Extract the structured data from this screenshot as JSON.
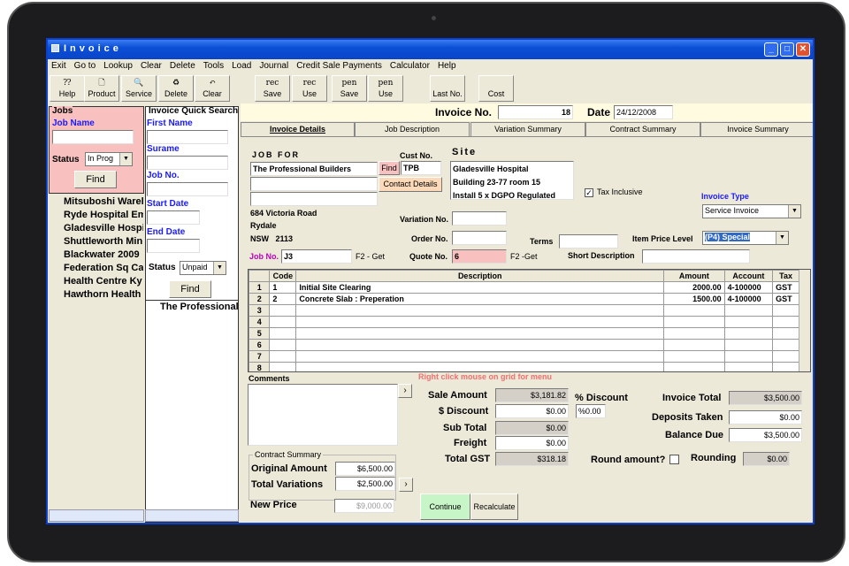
{
  "window": {
    "title": "Invoice"
  },
  "menu": [
    "Exit",
    "Go to",
    "Lookup",
    "Clear",
    "Delete",
    "Tools",
    "Load",
    "Journal",
    "Credit Sale Payments",
    "Calculator",
    "Help"
  ],
  "toolbar": [
    {
      "top": "",
      "label": "Help",
      "icon": "help-icon"
    },
    {
      "top": "",
      "label": "Product",
      "icon": "document-icon"
    },
    {
      "top": "",
      "label": "Service",
      "icon": "service-icon"
    },
    {
      "top": "",
      "label": "Delete",
      "icon": "recycle-bin-icon"
    },
    {
      "top": "",
      "label": "Clear",
      "icon": "undo-icon"
    },
    {
      "top": "rec",
      "label": "Save"
    },
    {
      "top": "rec",
      "label": "Use"
    },
    {
      "top": "pen",
      "label": "Save"
    },
    {
      "top": "pen",
      "label": "Use"
    },
    {
      "top": "",
      "label": "Last No."
    },
    {
      "top": "",
      "label": "Cost"
    }
  ],
  "jobs": {
    "title": "Jobs",
    "job_name_label": "Job Name",
    "job_name": "",
    "status_label": "Status",
    "status": "In Prog",
    "find": "Find"
  },
  "tree": [
    "Mitsuboshi Warehouse",
    "Ryde Hospital Em",
    "Gladesville Hospital",
    "Shuttleworth Min",
    "Blackwater 2009",
    "Federation Sq Ca",
    "Health Centre Ky",
    "Hawthorn Health"
  ],
  "quick": {
    "title": "Invoice Quick Search",
    "first_name": "First Name",
    "surname": "Surame",
    "job_no": "Job No.",
    "start_date": "Start Date",
    "end_date": "End Date",
    "status_label": "Status",
    "status": "Unpaid",
    "find": "Find",
    "tree_item": "The Professional"
  },
  "header": {
    "invoice_no_label": "Invoice No.",
    "invoice_no": "18",
    "date_label": "Date",
    "date": "24/12/2008"
  },
  "tabs": [
    "Invoice Details",
    "Job Description",
    "Variation Summary",
    "Contract Summary",
    "Invoice Summary"
  ],
  "form": {
    "job_for": "JOB FOR",
    "customer": "The Professional Builders",
    "find": "Find",
    "cust_no_label": "Cust No.",
    "cust_no": "TPB",
    "contact": "Contact Details",
    "site_label": "Site",
    "site": [
      "Gladesville Hospital",
      "Building 23-77 room 15",
      "Install 5 x DGPO Regulated"
    ],
    "tax_inclusive": "Tax Inclusive",
    "tax_checked": true,
    "address": [
      "684 Victoria Road",
      "Rydale",
      "NSW   2113"
    ],
    "variation_no": "Variation No.",
    "order_no": "Order No.",
    "terms": "Terms",
    "invoice_type_label": "Invoice Type",
    "invoice_type": "Service Invoice",
    "price_level_label": "Item Price Level",
    "price_level": "(P4) Special",
    "job_no_label": "Job No.",
    "job_no": "J3",
    "f2_get": "F2 - Get",
    "quote_no_label": "Quote No.",
    "quote_no": "6",
    "f2_get2": "F2 -Get",
    "short_desc": "Short Description"
  },
  "grid": {
    "columns": [
      "Code",
      "Description",
      "Amount",
      "Account",
      "Tax"
    ],
    "rows": [
      [
        "1",
        "Initial Site Clearing",
        "2000.00",
        "4-100000",
        "GST"
      ],
      [
        "2",
        "Concrete Slab : Preperation",
        "1500.00",
        "4-100000",
        "GST"
      ],
      [
        "",
        "",
        "",
        "",
        ""
      ],
      [
        "",
        "",
        "",
        "",
        ""
      ],
      [
        "",
        "",
        "",
        "",
        ""
      ],
      [
        "",
        "",
        "",
        "",
        ""
      ],
      [
        "",
        "",
        "",
        "",
        ""
      ],
      [
        "",
        "",
        "",
        "",
        ""
      ]
    ],
    "hint": "Right click mouse on grid for menu"
  },
  "comments": {
    "label": "Comments",
    "value": ""
  },
  "contract": {
    "title": "Contract Summary",
    "original_label": "Original Amount",
    "original": "$6,500.00",
    "variations_label": "Total Variations",
    "variations": "$2,500.00",
    "new_price_label": "New Price",
    "new_price": "$9,000.00"
  },
  "totals": {
    "sale_amount_label": "Sale Amount",
    "sale_amount": "$3,181.82",
    "discount_label": "$ Discount",
    "discount": "$0.00",
    "pct_discount_label": "% Discount",
    "pct_discount": "%0.00",
    "sub_total_label": "Sub Total",
    "sub_total": "$0.00",
    "freight_label": "Freight",
    "freight": "$0.00",
    "gst_label": "Total GST",
    "gst": "$318.18",
    "invoice_total_label": "Invoice Total",
    "invoice_total": "$3,500.00",
    "deposits_label": "Deposits Taken",
    "deposits": "$0.00",
    "balance_label": "Balance Due",
    "balance": "$3,500.00",
    "round_label": "Round amount?",
    "rounding_label": "Rounding",
    "rounding": "$0.00"
  },
  "buttons": {
    "continue": "Continue",
    "recalculate": "Recalculate"
  }
}
